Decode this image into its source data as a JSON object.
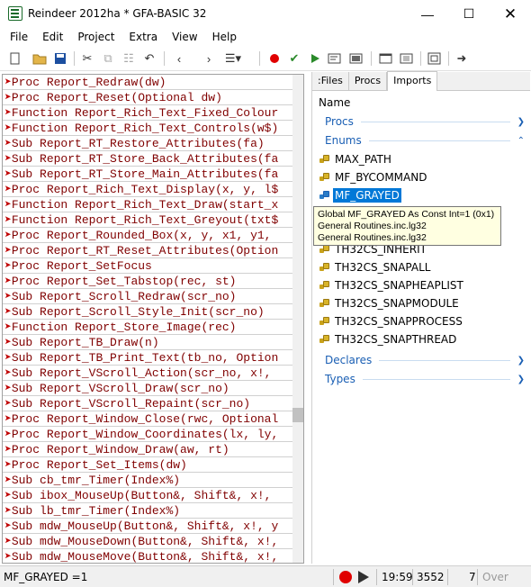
{
  "window": {
    "title": "Reindeer 2012ha * GFA-BASIC 32"
  },
  "menu": [
    "File",
    "Edit",
    "Project",
    "Extra",
    "View",
    "Help"
  ],
  "toolbar": {
    "buttons": [
      "cut-icon",
      "copy-icon",
      "paste-icon",
      "undo-icon",
      "back-icon",
      "forward-icon",
      "bookmark-list-icon",
      "record-icon",
      "check-icon",
      "run-icon",
      "compile-icon",
      "compile-exe-icon",
      "fullscreen-icon",
      "exit-icon"
    ],
    "colors": {
      "record": "#e00000",
      "check": "#2a8a2a",
      "run": "#2a8a2a"
    }
  },
  "code_lines": [
    {
      "kw": "Proc",
      "text": "Proc Report_Redraw(dw)"
    },
    {
      "kw": "Proc",
      "text": "Proc Report_Reset(Optional dw)"
    },
    {
      "kw": "Function",
      "text": "Function Report_Rich_Text_Fixed_Colour"
    },
    {
      "kw": "Function",
      "text": "Function Report_Rich_Text_Controls(w$)"
    },
    {
      "kw": "Sub",
      "text": "Sub Report_RT_Restore_Attributes(fa)"
    },
    {
      "kw": "Sub",
      "text": "Sub Report_RT_Store_Back_Attributes(fa"
    },
    {
      "kw": "Sub",
      "text": "Sub Report_RT_Store_Main_Attributes(fa"
    },
    {
      "kw": "Proc",
      "text": "Proc Report_Rich_Text_Display(x, y, l$"
    },
    {
      "kw": "Function",
      "text": "Function Report_Rich_Text_Draw(start_x"
    },
    {
      "kw": "Function",
      "text": "Function Report_Rich_Text_Greyout(txt$"
    },
    {
      "kw": "Proc",
      "text": "Proc Report_Rounded_Box(x, y, x1, y1,"
    },
    {
      "kw": "Proc",
      "text": "Proc Report_RT_Reset_Attributes(Option"
    },
    {
      "kw": "Proc",
      "text": "Proc Report_SetFocus"
    },
    {
      "kw": "Proc",
      "text": "Proc Report_Set_Tabstop(rec, st)"
    },
    {
      "kw": "Sub",
      "text": "Sub Report_Scroll_Redraw(scr_no)"
    },
    {
      "kw": "Sub",
      "text": "Sub Report_Scroll_Style_Init(scr_no)"
    },
    {
      "kw": "Function",
      "text": "Function Report_Store_Image(rec)"
    },
    {
      "kw": "Sub",
      "text": "Sub Report_TB_Draw(n)"
    },
    {
      "kw": "Sub",
      "text": "Sub Report_TB_Print_Text(tb_no, Option"
    },
    {
      "kw": "Sub",
      "text": "Sub Report_VScroll_Action(scr_no, x!,"
    },
    {
      "kw": "Sub",
      "text": "Sub Report_VScroll_Draw(scr_no)"
    },
    {
      "kw": "Sub",
      "text": "Sub Report_VScroll_Repaint(scr_no)"
    },
    {
      "kw": "Proc",
      "text": "Proc Report_Window_Close(rwc, Optional"
    },
    {
      "kw": "Proc",
      "text": "Proc Report_Window_Coordinates(lx, ly,"
    },
    {
      "kw": "Proc",
      "text": "Proc Report_Window_Draw(aw, rt)"
    },
    {
      "kw": "Proc",
      "text": "Proc Report_Set_Items(dw)"
    },
    {
      "kw": "Sub",
      "text": "Sub cb_tmr_Timer(Index%)"
    },
    {
      "kw": "Sub",
      "text": "Sub ibox_MouseUp(Button&, Shift&, x!,"
    },
    {
      "kw": "Sub",
      "text": "Sub lb_tmr_Timer(Index%)"
    },
    {
      "kw": "Sub",
      "text": "Sub mdw_MouseUp(Button&, Shift&, x!, y"
    },
    {
      "kw": "Sub",
      "text": "Sub mdw_MouseDown(Button&, Shift&, x!,"
    },
    {
      "kw": "Sub",
      "text": "Sub mdw_MouseMove(Button&, Shift&, x!,"
    }
  ],
  "sidepane": {
    "tabs": [
      ":Files",
      "Procs",
      "Imports"
    ],
    "active_tab": "Imports",
    "header": "Name",
    "groups": {
      "procs": "Procs",
      "enums": "Enums",
      "declares": "Declares",
      "types": "Types"
    },
    "enum_items": [
      "MAX_PATH",
      "MF_BYCOMMAND",
      "MF_GRAYED",
      "TH32CS_INHERIT",
      "TH32CS_SNAPALL",
      "TH32CS_SNAPHEAPLIST",
      "TH32CS_SNAPMODULE",
      "TH32CS_SNAPPROCESS",
      "TH32CS_SNAPTHREAD"
    ],
    "selected_item": "MF_GRAYED",
    "tooltip": [
      "Global MF_GRAYED As Const Int=1 (0x1)",
      "General Routines.inc.lg32",
      "General Routines.inc.lg32"
    ]
  },
  "status": {
    "text": "MF_GRAYED =1",
    "time": "19:59",
    "line": "3552",
    "col": "7",
    "mode": "Over"
  }
}
